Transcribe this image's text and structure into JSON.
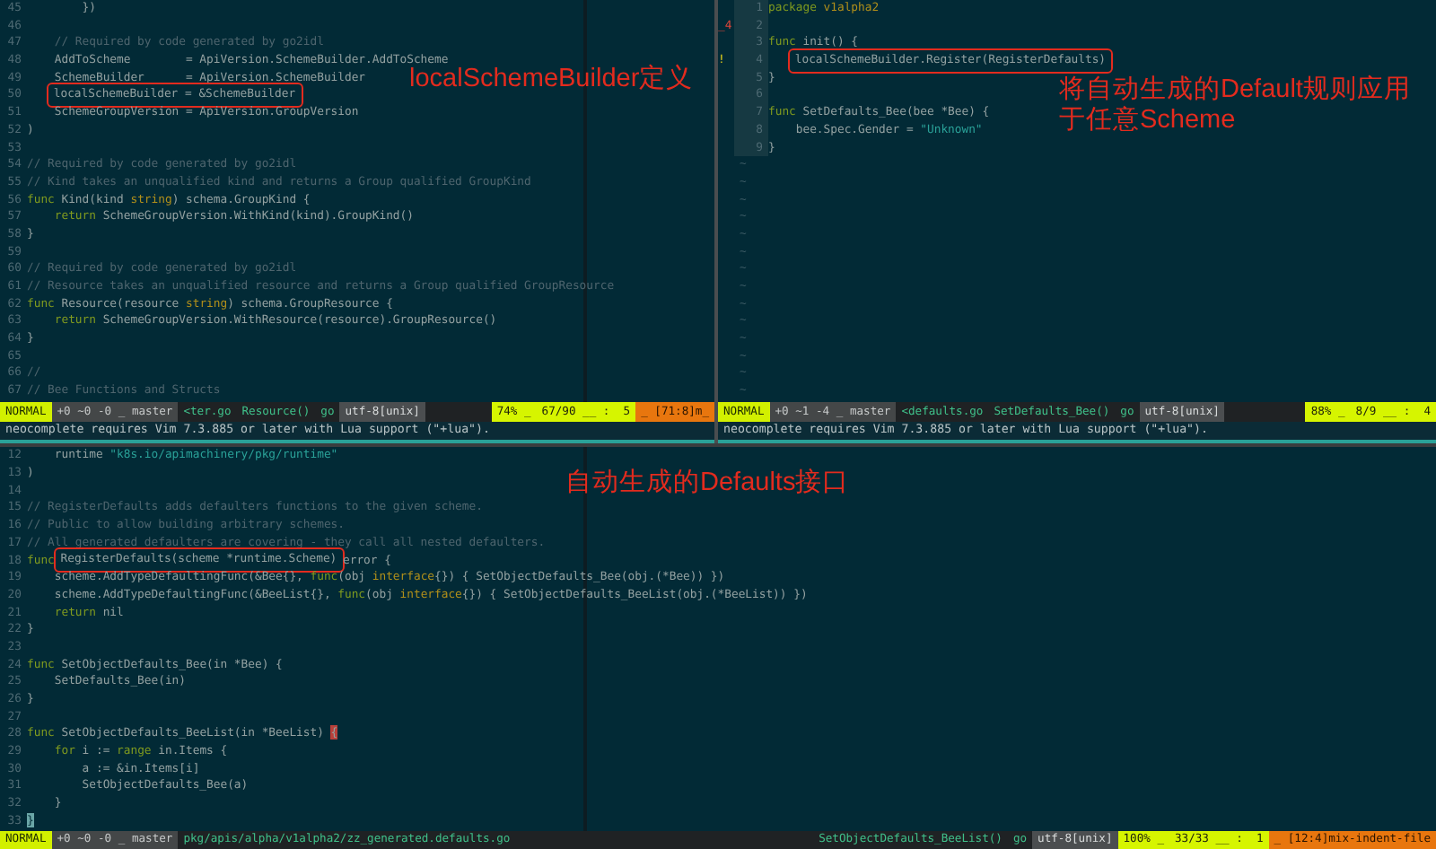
{
  "panes": [
    {
      "lines": [
        {
          "number": "45",
          "segments": [
            {
              "text": "        })",
              "kind": "plain"
            }
          ]
        },
        {
          "number": "46"
        },
        {
          "number": "47",
          "segments": [
            {
              "text": "    // Required by code generated by go2idl",
              "kind": "comment"
            }
          ]
        },
        {
          "number": "48",
          "segments": [
            {
              "text": "    AddToScheme        = ApiVersion.SchemeBuilder.AddToScheme",
              "kind": "plain"
            }
          ]
        },
        {
          "number": "49",
          "segments": [
            {
              "text": "    SchemeBuilder      = ApiVersion.SchemeBuilder",
              "kind": "plain"
            }
          ]
        },
        {
          "number": "50",
          "segments": [
            {
              "text": "    localSchemeBuilder = &SchemeBuilder",
              "kind": "plain",
              "boxed": true
            }
          ]
        },
        {
          "number": "51",
          "segments": [
            {
              "text": "    SchemeGroupVersion = ApiVersion.GroupVersion",
              "kind": "plain"
            }
          ]
        },
        {
          "number": "52",
          "segments": [
            {
              "text": ")",
              "kind": "plain"
            }
          ]
        },
        {
          "number": "53"
        },
        {
          "number": "54",
          "segments": [
            {
              "text": "// Required by code generated by go2idl",
              "kind": "comment"
            }
          ]
        },
        {
          "number": "55",
          "segments": [
            {
              "text": "// Kind takes an unqualified kind and returns a Group qualified GroupKind",
              "kind": "comment"
            }
          ]
        },
        {
          "number": "56",
          "segments": [
            {
              "text": "func",
              "kind": "keyword"
            },
            {
              "text": " Kind(kind ",
              "kind": "plain"
            },
            {
              "text": "string",
              "kind": "type"
            },
            {
              "text": ") schema.GroupKind {",
              "kind": "plain"
            }
          ]
        },
        {
          "number": "57",
          "segments": [
            {
              "text": "    return",
              "kind": "keyword"
            },
            {
              "text": " SchemeGroupVersion.WithKind(kind).GroupKind()",
              "kind": "plain"
            }
          ]
        },
        {
          "number": "58",
          "segments": [
            {
              "text": "}",
              "kind": "plain"
            }
          ]
        },
        {
          "number": "59"
        },
        {
          "number": "60",
          "segments": [
            {
              "text": "// Required by code generated by go2idl",
              "kind": "comment"
            }
          ]
        },
        {
          "number": "61",
          "segments": [
            {
              "text": "// Resource takes an unqualified resource and returns a Group qualified GroupResource",
              "kind": "comment"
            }
          ]
        },
        {
          "number": "62",
          "segments": [
            {
              "text": "func",
              "kind": "keyword"
            },
            {
              "text": " Resource(resource ",
              "kind": "plain"
            },
            {
              "text": "string",
              "kind": "type"
            },
            {
              "text": ") schema.GroupResource {",
              "kind": "plain"
            }
          ]
        },
        {
          "number": "63",
          "segments": [
            {
              "text": "    return",
              "kind": "keyword"
            },
            {
              "text": " SchemeGroupVersion.WithResource(resource).GroupResource()",
              "kind": "plain"
            }
          ]
        },
        {
          "number": "64",
          "segments": [
            {
              "text": "}",
              "kind": "plain"
            }
          ]
        },
        {
          "number": "65"
        },
        {
          "number": "66",
          "segments": [
            {
              "text": "//",
              "kind": "comment"
            }
          ]
        },
        {
          "number": "67",
          "segments": [
            {
              "text": "// Bee Functions and Structs",
              "kind": "comment"
            }
          ]
        }
      ],
      "annotation": [
        "localSchemeBuilder定义"
      ],
      "status": {
        "left": [
          {
            "text": "NORMAL",
            "kind": "mode"
          },
          {
            "text": "+0 ~0 -0 _ master",
            "kind": "git"
          },
          {
            "text": "<ter.go",
            "kind": "file"
          },
          {
            "text": "Resource()",
            "kind": "file"
          },
          {
            "text": "go",
            "kind": "file"
          },
          {
            "text": "utf-8[unix]",
            "kind": "encoding"
          }
        ],
        "right": [
          {
            "text": "74% _",
            "kind": "position"
          },
          {
            "text": "67/90 __ :  5",
            "kind": "position"
          },
          {
            "text": "_ [71:8]m_",
            "kind": "warning"
          }
        ]
      },
      "message": "neocomplete requires Vim 7.3.885 or later with Lua support (\"+lua\")."
    },
    {
      "lines": [
        {
          "number": "1",
          "segments": [
            {
              "text": "package",
              "kind": "keyword"
            },
            {
              "text": " v1alpha2",
              "kind": "type"
            }
          ]
        },
        {
          "number": "2",
          "sign": {
            "text": "_4",
            "kind": "removed"
          }
        },
        {
          "number": "3",
          "segments": [
            {
              "text": "func",
              "kind": "keyword"
            },
            {
              "text": " init() {",
              "kind": "plain"
            }
          ]
        },
        {
          "number": "4",
          "sign": {
            "text": "!",
            "kind": "warning"
          },
          "segments": [
            {
              "text": "    localSchemeBuilder.Register(RegisterDefaults)",
              "kind": "plain",
              "boxed": true
            }
          ]
        },
        {
          "number": "5",
          "segments": [
            {
              "text": "}",
              "kind": "plain"
            }
          ]
        },
        {
          "number": "6"
        },
        {
          "number": "7",
          "segments": [
            {
              "text": "func",
              "kind": "keyword"
            },
            {
              "text": " SetDefaults_Bee(bee *Bee) {",
              "kind": "plain"
            }
          ]
        },
        {
          "number": "8",
          "segments": [
            {
              "text": "    bee.Spec.Gender = ",
              "kind": "plain"
            },
            {
              "text": "\"Unknown\"",
              "kind": "string"
            }
          ]
        },
        {
          "number": "9",
          "segments": [
            {
              "text": "}",
              "kind": "plain"
            }
          ]
        }
      ],
      "fillers": [
        "~",
        "~",
        "~",
        "~",
        "~",
        "~",
        "~",
        "~",
        "~",
        "~",
        "~",
        "~",
        "~",
        "~"
      ],
      "annotation": [
        "将自动生成的Default规则应用",
        "于任意Scheme"
      ],
      "status": {
        "left": [
          {
            "text": "NORMAL",
            "kind": "mode"
          },
          {
            "text": "+0 ~1 -4 _ master",
            "kind": "git"
          },
          {
            "text": "<defaults.go",
            "kind": "file"
          },
          {
            "text": "SetDefaults_Bee()",
            "kind": "file"
          },
          {
            "text": "go",
            "kind": "file"
          },
          {
            "text": "utf-8[unix]",
            "kind": "encoding"
          }
        ],
        "right": [
          {
            "text": "88% _",
            "kind": "position"
          },
          {
            "text": "8/9 __ :  4",
            "kind": "position"
          }
        ]
      },
      "message": "neocomplete requires Vim 7.3.885 or later with Lua support (\"+lua\")."
    },
    {
      "lines": [
        {
          "number": "12",
          "segments": [
            {
              "text": "    runtime ",
              "kind": "plain"
            },
            {
              "text": "\"k8s.io/apimachinery/pkg/runtime\"",
              "kind": "string"
            }
          ]
        },
        {
          "number": "13",
          "segments": [
            {
              "text": ")",
              "kind": "plain"
            }
          ]
        },
        {
          "number": "14"
        },
        {
          "number": "15",
          "segments": [
            {
              "text": "// RegisterDefaults adds defaulters functions to the given scheme.",
              "kind": "comment"
            }
          ]
        },
        {
          "number": "16",
          "segments": [
            {
              "text": "// Public to allow building arbitrary schemes.",
              "kind": "comment"
            }
          ]
        },
        {
          "number": "17",
          "segments": [
            {
              "text": "// All generated defaulters are covering - they call all nested defaulters.",
              "kind": "comment"
            }
          ]
        },
        {
          "number": "18",
          "segments": [
            {
              "text": "func",
              "kind": "keyword"
            },
            {
              "text": " RegisterDefaults(scheme *runtime.Scheme)",
              "kind": "plain",
              "boxed": true
            },
            {
              "text": " error {",
              "kind": "plain"
            }
          ]
        },
        {
          "number": "19",
          "segments": [
            {
              "text": "    scheme.AddTypeDefaultingFunc(&Bee{}, ",
              "kind": "plain"
            },
            {
              "text": "func",
              "kind": "keyword"
            },
            {
              "text": "(obj ",
              "kind": "plain"
            },
            {
              "text": "interface",
              "kind": "type"
            },
            {
              "text": "{}) { SetObjectDefaults_Bee(obj.(*Bee)) })",
              "kind": "plain"
            }
          ]
        },
        {
          "number": "20",
          "segments": [
            {
              "text": "    scheme.AddTypeDefaultingFunc(&BeeList{}, ",
              "kind": "plain"
            },
            {
              "text": "func",
              "kind": "keyword"
            },
            {
              "text": "(obj ",
              "kind": "plain"
            },
            {
              "text": "interface",
              "kind": "type"
            },
            {
              "text": "{}) { SetObjectDefaults_BeeList(obj.(*BeeList)) })",
              "kind": "plain"
            }
          ]
        },
        {
          "number": "21",
          "segments": [
            {
              "text": "    return",
              "kind": "keyword"
            },
            {
              "text": " nil",
              "kind": "plain"
            }
          ]
        },
        {
          "number": "22",
          "segments": [
            {
              "text": "}",
              "kind": "plain"
            }
          ]
        },
        {
          "number": "23"
        },
        {
          "number": "24",
          "segments": [
            {
              "text": "func",
              "kind": "keyword"
            },
            {
              "text": " SetObjectDefaults_Bee(in *Bee) {",
              "kind": "plain"
            }
          ]
        },
        {
          "number": "25",
          "segments": [
            {
              "text": "    SetDefaults_Bee(in)",
              "kind": "plain"
            }
          ]
        },
        {
          "number": "26",
          "segments": [
            {
              "text": "}",
              "kind": "plain"
            }
          ]
        },
        {
          "number": "27"
        },
        {
          "number": "28",
          "segments": [
            {
              "text": "func",
              "kind": "keyword"
            },
            {
              "text": " SetObjectDefaults_BeeList(in *BeeList) ",
              "kind": "plain"
            },
            {
              "text": "{",
              "kind": "match"
            }
          ]
        },
        {
          "number": "29",
          "segments": [
            {
              "text": "    for",
              "kind": "keyword"
            },
            {
              "text": " i := ",
              "kind": "plain"
            },
            {
              "text": "range",
              "kind": "keyword"
            },
            {
              "text": " in.Items {",
              "kind": "plain"
            }
          ]
        },
        {
          "number": "30",
          "segments": [
            {
              "text": "        a := &in.Items[i]",
              "kind": "plain"
            }
          ]
        },
        {
          "number": "31",
          "segments": [
            {
              "text": "        SetObjectDefaults_Bee(a)",
              "kind": "plain"
            }
          ]
        },
        {
          "number": "32",
          "segments": [
            {
              "text": "    }",
              "kind": "plain"
            }
          ]
        },
        {
          "number": "33",
          "segments": [
            {
              "text": "}",
              "kind": "cursor"
            }
          ]
        }
      ],
      "annotation": [
        "自动生成的Defaults接口"
      ],
      "status": {
        "left": [
          {
            "text": "NORMAL",
            "kind": "mode"
          },
          {
            "text": "+0 ~0 -0 _ master",
            "kind": "git"
          },
          {
            "text": "pkg/apis/alpha/v1alpha2/zz_generated.defaults.go",
            "kind": "file"
          }
        ],
        "right": [
          {
            "text": "SetObjectDefaults_BeeList()",
            "kind": "file"
          },
          {
            "text": "go",
            "kind": "file"
          },
          {
            "text": "utf-8[unix]",
            "kind": "encoding"
          },
          {
            "text": "100% _",
            "kind": "position"
          },
          {
            "text": "33/33 __ :  1",
            "kind": "position"
          },
          {
            "text": "_ [12:4]mix-indent-file",
            "kind": "warning"
          }
        ]
      }
    }
  ]
}
